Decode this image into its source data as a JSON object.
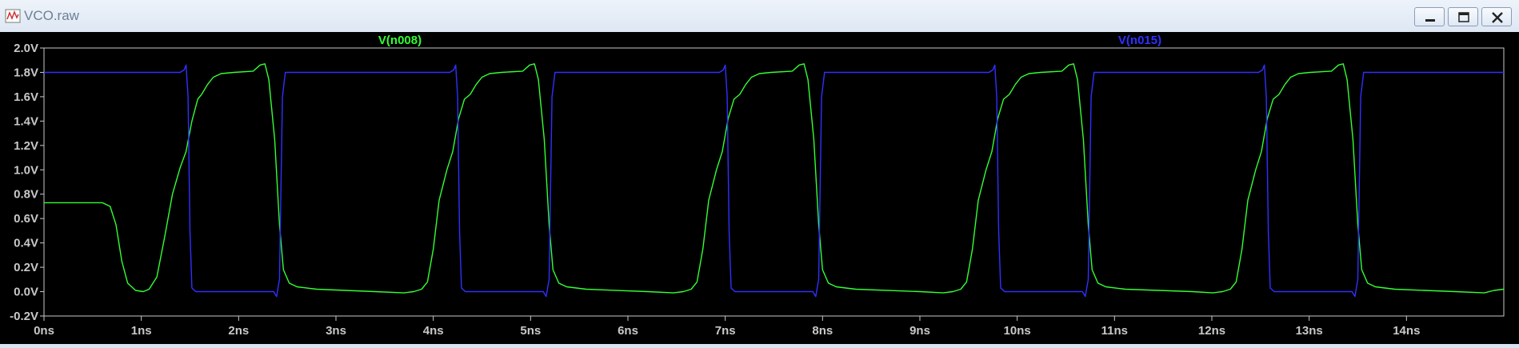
{
  "window": {
    "title": "VCO.raw",
    "icons": [
      "waveform-app-icon",
      "minimize-icon",
      "maximize-icon",
      "close-icon"
    ]
  },
  "chart_data": {
    "type": "line",
    "title": "",
    "xlabel": "",
    "ylabel": "",
    "xlim": [
      0,
      15
    ],
    "ylim": [
      -0.2,
      2.0
    ],
    "x_unit": "ns",
    "y_unit": "V",
    "grid": false,
    "background": "#000000",
    "axis_color": "#c8c8c8",
    "x_ticks": [
      0,
      1,
      2,
      3,
      4,
      5,
      6,
      7,
      8,
      9,
      10,
      11,
      12,
      13,
      14
    ],
    "x_tick_labels": [
      "0ns",
      "1ns",
      "2ns",
      "3ns",
      "4ns",
      "5ns",
      "6ns",
      "7ns",
      "8ns",
      "9ns",
      "10ns",
      "11ns",
      "12ns",
      "13ns",
      "14ns"
    ],
    "y_ticks": [
      -0.2,
      0.0,
      0.2,
      0.4,
      0.6,
      0.8,
      1.0,
      1.2,
      1.4,
      1.6,
      1.8,
      2.0
    ],
    "y_tick_labels": [
      "-0.2V",
      "0.0V",
      "0.2V",
      "0.4V",
      "0.6V",
      "0.8V",
      "1.0V",
      "1.2V",
      "1.4V",
      "1.6V",
      "1.8V",
      "2.0V"
    ],
    "legend_placement": "top",
    "series": [
      {
        "name": "V(n008)",
        "color": "#33ff33",
        "points": [
          [
            0.0,
            0.73
          ],
          [
            0.6,
            0.73
          ],
          [
            0.68,
            0.7
          ],
          [
            0.74,
            0.55
          ],
          [
            0.8,
            0.25
          ],
          [
            0.86,
            0.07
          ],
          [
            0.94,
            0.01
          ],
          [
            1.02,
            0.0
          ],
          [
            1.08,
            0.02
          ],
          [
            1.16,
            0.12
          ],
          [
            1.24,
            0.45
          ],
          [
            1.32,
            0.8
          ],
          [
            1.4,
            1.02
          ],
          [
            1.46,
            1.15
          ],
          [
            1.52,
            1.4
          ],
          [
            1.58,
            1.58
          ],
          [
            1.62,
            1.62
          ],
          [
            1.68,
            1.7
          ],
          [
            1.74,
            1.76
          ],
          [
            1.82,
            1.79
          ],
          [
            1.95,
            1.8
          ],
          [
            2.15,
            1.81
          ],
          [
            2.22,
            1.86
          ],
          [
            2.27,
            1.87
          ],
          [
            2.31,
            1.74
          ],
          [
            2.37,
            1.25
          ],
          [
            2.42,
            0.55
          ],
          [
            2.46,
            0.18
          ],
          [
            2.52,
            0.07
          ],
          [
            2.6,
            0.04
          ],
          [
            2.8,
            0.02
          ],
          [
            3.4,
            0.0
          ],
          [
            3.7,
            -0.01
          ],
          [
            3.8,
            0.0
          ],
          [
            3.88,
            0.02
          ],
          [
            3.94,
            0.08
          ],
          [
            4.0,
            0.35
          ],
          [
            4.06,
            0.75
          ],
          [
            4.14,
            1.0
          ],
          [
            4.2,
            1.15
          ],
          [
            4.26,
            1.42
          ],
          [
            4.32,
            1.58
          ],
          [
            4.38,
            1.62
          ],
          [
            4.44,
            1.7
          ],
          [
            4.5,
            1.76
          ],
          [
            4.58,
            1.79
          ],
          [
            4.7,
            1.8
          ],
          [
            4.92,
            1.81
          ],
          [
            4.99,
            1.86
          ],
          [
            5.04,
            1.87
          ],
          [
            5.08,
            1.74
          ],
          [
            5.14,
            1.25
          ],
          [
            5.19,
            0.55
          ],
          [
            5.23,
            0.18
          ],
          [
            5.29,
            0.07
          ],
          [
            5.37,
            0.04
          ],
          [
            5.57,
            0.02
          ],
          [
            6.2,
            0.0
          ],
          [
            6.47,
            -0.01
          ],
          [
            6.57,
            0.0
          ],
          [
            6.65,
            0.02
          ],
          [
            6.71,
            0.08
          ],
          [
            6.77,
            0.35
          ],
          [
            6.83,
            0.75
          ],
          [
            6.91,
            1.0
          ],
          [
            6.97,
            1.15
          ],
          [
            7.03,
            1.42
          ],
          [
            7.09,
            1.58
          ],
          [
            7.15,
            1.62
          ],
          [
            7.21,
            1.7
          ],
          [
            7.27,
            1.76
          ],
          [
            7.35,
            1.79
          ],
          [
            7.47,
            1.8
          ],
          [
            7.69,
            1.81
          ],
          [
            7.76,
            1.86
          ],
          [
            7.81,
            1.87
          ],
          [
            7.85,
            1.74
          ],
          [
            7.91,
            1.25
          ],
          [
            7.96,
            0.55
          ],
          [
            8.0,
            0.18
          ],
          [
            8.06,
            0.07
          ],
          [
            8.14,
            0.04
          ],
          [
            8.34,
            0.02
          ],
          [
            9.0,
            0.0
          ],
          [
            9.24,
            -0.01
          ],
          [
            9.34,
            0.0
          ],
          [
            9.42,
            0.02
          ],
          [
            9.48,
            0.08
          ],
          [
            9.54,
            0.35
          ],
          [
            9.6,
            0.75
          ],
          [
            9.68,
            1.0
          ],
          [
            9.74,
            1.15
          ],
          [
            9.8,
            1.42
          ],
          [
            9.86,
            1.58
          ],
          [
            9.92,
            1.62
          ],
          [
            9.98,
            1.7
          ],
          [
            10.04,
            1.76
          ],
          [
            10.12,
            1.79
          ],
          [
            10.24,
            1.8
          ],
          [
            10.46,
            1.81
          ],
          [
            10.53,
            1.86
          ],
          [
            10.58,
            1.87
          ],
          [
            10.62,
            1.74
          ],
          [
            10.68,
            1.25
          ],
          [
            10.73,
            0.55
          ],
          [
            10.77,
            0.18
          ],
          [
            10.83,
            0.07
          ],
          [
            10.91,
            0.04
          ],
          [
            11.11,
            0.02
          ],
          [
            11.8,
            0.0
          ],
          [
            12.01,
            -0.01
          ],
          [
            12.11,
            0.0
          ],
          [
            12.19,
            0.02
          ],
          [
            12.25,
            0.08
          ],
          [
            12.31,
            0.35
          ],
          [
            12.37,
            0.75
          ],
          [
            12.45,
            1.0
          ],
          [
            12.51,
            1.15
          ],
          [
            12.57,
            1.42
          ],
          [
            12.63,
            1.58
          ],
          [
            12.69,
            1.62
          ],
          [
            12.75,
            1.7
          ],
          [
            12.81,
            1.76
          ],
          [
            12.89,
            1.79
          ],
          [
            13.01,
            1.8
          ],
          [
            13.23,
            1.81
          ],
          [
            13.3,
            1.86
          ],
          [
            13.35,
            1.87
          ],
          [
            13.39,
            1.74
          ],
          [
            13.45,
            1.25
          ],
          [
            13.5,
            0.55
          ],
          [
            13.54,
            0.18
          ],
          [
            13.6,
            0.07
          ],
          [
            13.68,
            0.04
          ],
          [
            13.88,
            0.02
          ],
          [
            14.5,
            0.0
          ],
          [
            14.8,
            -0.01
          ],
          [
            14.9,
            0.01
          ],
          [
            15.0,
            0.02
          ]
        ]
      },
      {
        "name": "V(n015)",
        "color": "#3030ff",
        "points": [
          [
            0.0,
            1.8
          ],
          [
            1.4,
            1.8
          ],
          [
            1.44,
            1.82
          ],
          [
            1.46,
            1.86
          ],
          [
            1.48,
            1.6
          ],
          [
            1.5,
            0.5
          ],
          [
            1.52,
            0.03
          ],
          [
            1.56,
            0.0
          ],
          [
            2.36,
            0.0
          ],
          [
            2.39,
            -0.04
          ],
          [
            2.42,
            0.1
          ],
          [
            2.45,
            1.6
          ],
          [
            2.48,
            1.8
          ],
          [
            4.17,
            1.8
          ],
          [
            4.21,
            1.82
          ],
          [
            4.23,
            1.86
          ],
          [
            4.25,
            1.6
          ],
          [
            4.27,
            0.5
          ],
          [
            4.29,
            0.03
          ],
          [
            4.33,
            0.0
          ],
          [
            5.13,
            0.0
          ],
          [
            5.16,
            -0.04
          ],
          [
            5.19,
            0.1
          ],
          [
            5.22,
            1.6
          ],
          [
            5.25,
            1.8
          ],
          [
            6.94,
            1.8
          ],
          [
            6.98,
            1.82
          ],
          [
            7.0,
            1.86
          ],
          [
            7.02,
            1.6
          ],
          [
            7.04,
            0.5
          ],
          [
            7.06,
            0.03
          ],
          [
            7.1,
            0.0
          ],
          [
            7.9,
            0.0
          ],
          [
            7.93,
            -0.04
          ],
          [
            7.96,
            0.1
          ],
          [
            7.99,
            1.6
          ],
          [
            8.02,
            1.8
          ],
          [
            9.71,
            1.8
          ],
          [
            9.75,
            1.82
          ],
          [
            9.77,
            1.86
          ],
          [
            9.79,
            1.6
          ],
          [
            9.81,
            0.5
          ],
          [
            9.83,
            0.03
          ],
          [
            9.87,
            0.0
          ],
          [
            10.67,
            0.0
          ],
          [
            10.7,
            -0.04
          ],
          [
            10.73,
            0.1
          ],
          [
            10.76,
            1.6
          ],
          [
            10.79,
            1.8
          ],
          [
            12.48,
            1.8
          ],
          [
            12.52,
            1.82
          ],
          [
            12.54,
            1.86
          ],
          [
            12.56,
            1.6
          ],
          [
            12.58,
            0.5
          ],
          [
            12.6,
            0.03
          ],
          [
            12.64,
            0.0
          ],
          [
            13.44,
            0.0
          ],
          [
            13.47,
            -0.04
          ],
          [
            13.5,
            0.1
          ],
          [
            13.53,
            1.6
          ],
          [
            13.56,
            1.8
          ],
          [
            15.0,
            1.8
          ]
        ]
      }
    ]
  }
}
